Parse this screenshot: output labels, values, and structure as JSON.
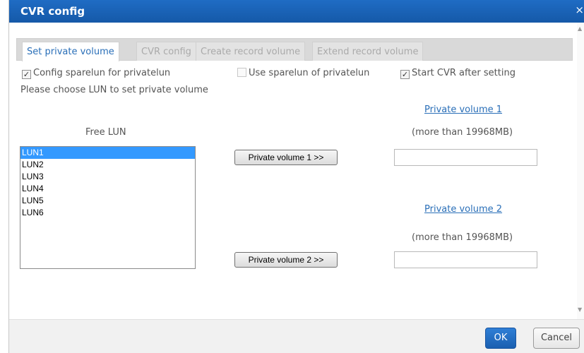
{
  "dialog": {
    "title": "CVR config",
    "close_glyph": "×",
    "accent_color": "#1a64b8"
  },
  "tabs": [
    {
      "label": "Set private volume",
      "active": true
    },
    {
      "label": "CVR config",
      "active": false
    },
    {
      "label": "Create record volume",
      "active": false
    },
    {
      "label": "Extend record volume",
      "active": false
    }
  ],
  "options": {
    "config_sparelun": {
      "label": "Config sparelun for privatelun",
      "checked": true
    },
    "use_sparelun": {
      "label": "Use sparelun of privatelun",
      "checked": false,
      "disabled": true
    },
    "start_cvr": {
      "label": "Start CVR after setting",
      "checked": true
    }
  },
  "instruction": "Please choose LUN to set private volume",
  "free_lun": {
    "heading": "Free LUN",
    "items": [
      "LUN1",
      "LUN2",
      "LUN3",
      "LUN4",
      "LUN5",
      "LUN6"
    ],
    "selected": "LUN1"
  },
  "private_volume_1": {
    "link": "Private volume 1",
    "note": "(more than 19968MB)",
    "button": "Private volume 1 >>",
    "value": ""
  },
  "private_volume_2": {
    "link": "Private volume 2",
    "note": "(more than 19968MB)",
    "button": "Private volume 2 >>",
    "value": ""
  },
  "footer": {
    "ok_label": "OK",
    "cancel_label": "Cancel"
  }
}
